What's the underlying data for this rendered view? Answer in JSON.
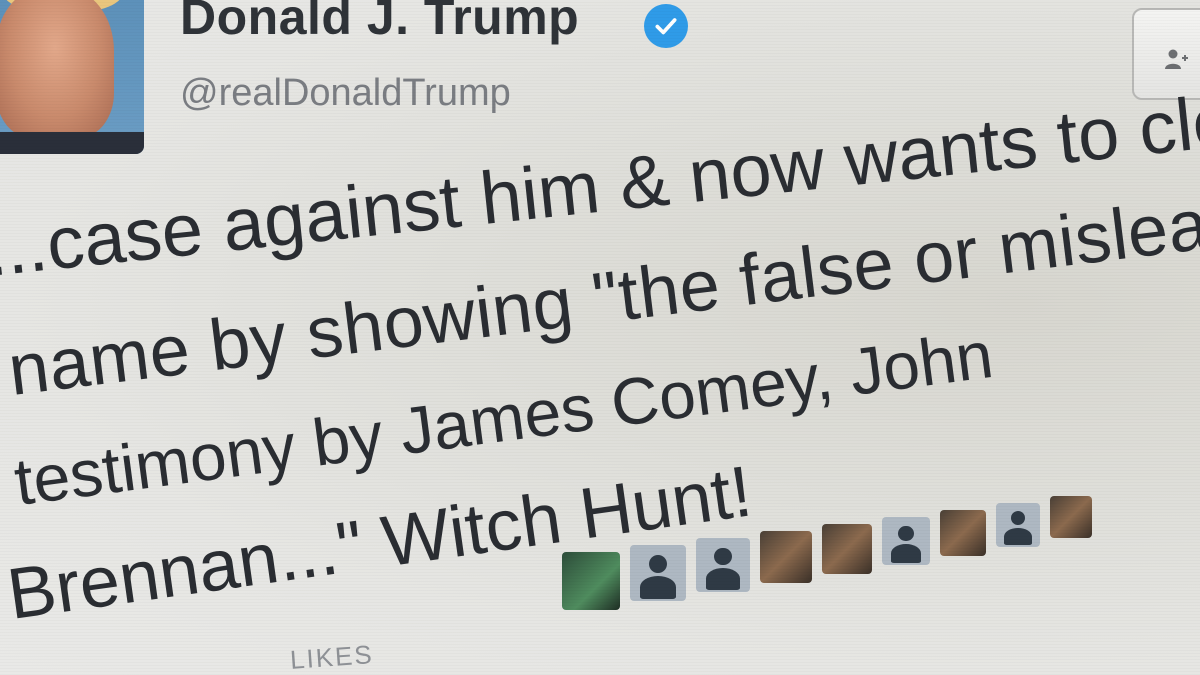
{
  "profile": {
    "name": "Donald J. Trump",
    "handle": "@realDonaldTrump",
    "verified": true
  },
  "tweet": {
    "lines": [
      "...case against him & now wants to cle",
      "name by showing \"the false or mislead",
      "testimony by James Comey, John",
      "Brennan...\" Witch Hunt!"
    ]
  },
  "stats": {
    "likes_label": "LIKES"
  },
  "liker_avatars": [
    {
      "icon": "photo-avatar-icon",
      "style": "green"
    },
    {
      "icon": "default-avatar-icon",
      "style": "default"
    },
    {
      "icon": "default-avatar-icon",
      "style": "default"
    },
    {
      "icon": "photo-avatar-icon",
      "style": "photo"
    },
    {
      "icon": "photo-avatar-icon",
      "style": "photo"
    },
    {
      "icon": "default-avatar-icon",
      "style": "default"
    },
    {
      "icon": "photo-avatar-icon",
      "style": "photo"
    },
    {
      "icon": "default-avatar-icon",
      "style": "default"
    },
    {
      "icon": "photo-avatar-icon",
      "style": "photo"
    }
  ],
  "colors": {
    "verified_badge": "#2f9be8",
    "text_primary": "#2a2d32",
    "text_secondary": "#7a7d82"
  }
}
